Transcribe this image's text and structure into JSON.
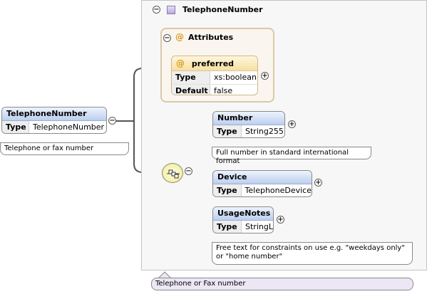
{
  "root": {
    "name": "TelephoneNumber",
    "type_label": "Type",
    "type_value": "TelephoneNumber",
    "annotation": "Telephone or fax number"
  },
  "complex_type": {
    "name": "TelephoneNumber",
    "annotation": "Telephone or Fax number"
  },
  "attributes": {
    "group_label": "Attributes",
    "items": [
      {
        "name": "preferred",
        "rows": [
          {
            "key": "Type",
            "value": "xs:boolean"
          },
          {
            "key": "Default",
            "value": "false"
          }
        ]
      }
    ]
  },
  "sequence": {
    "elements": [
      {
        "name": "Number",
        "type_label": "Type",
        "type_value": "String255",
        "annotation": "Full number in standard international format"
      },
      {
        "name": "Device",
        "type_label": "Type",
        "type_value": "TelephoneDevice"
      },
      {
        "name": "UsageNotes",
        "type_label": "Type",
        "type_value": "StringL",
        "annotation": "Free text for constraints on use e.g. \"weekdays only\" or \"home number\""
      }
    ]
  },
  "symbols": {
    "collapse": "−",
    "expand": "+",
    "attribute_marker": "@"
  }
}
